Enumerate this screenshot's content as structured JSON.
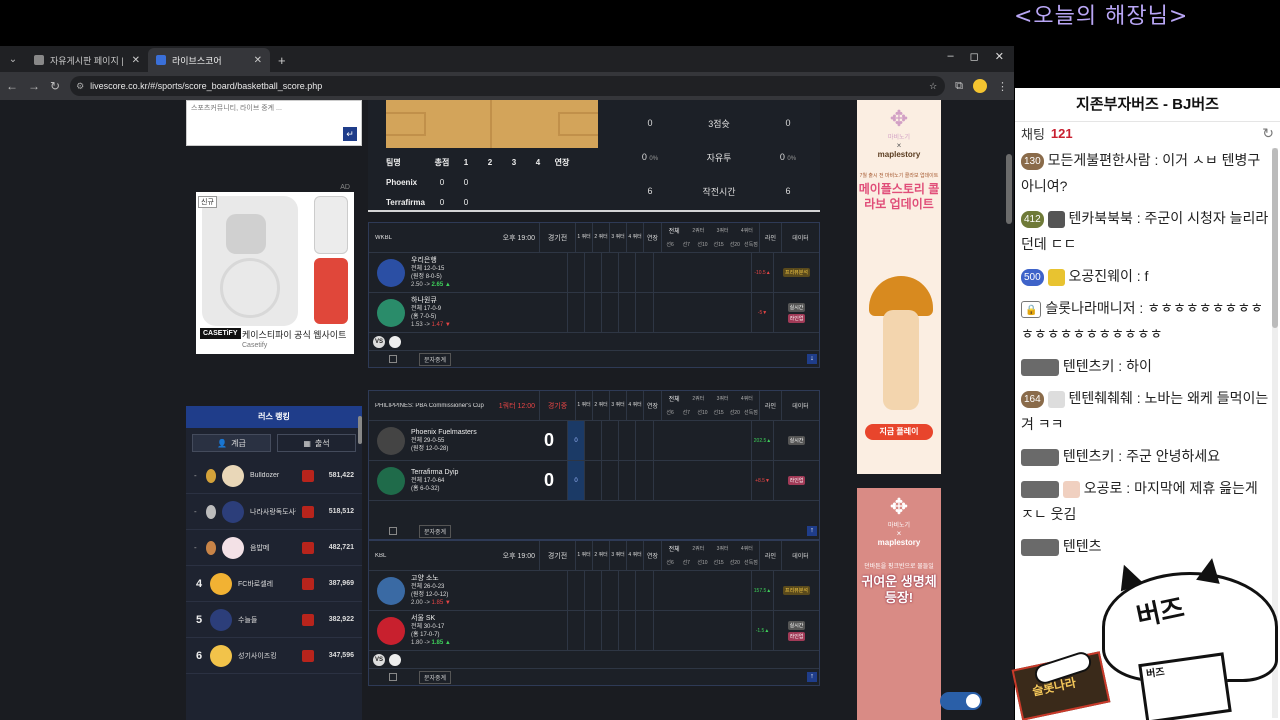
{
  "overlay": {
    "title": "<오늘의 해장님>"
  },
  "browser": {
    "tabs": [
      {
        "label": "자유게시판 페이지 | 쓸롯나라",
        "active": false
      },
      {
        "label": "라이브스코어",
        "active": true
      }
    ],
    "new_tab": "+",
    "url": "livescore.co.kr/#/sports/score_board/basketball_score.php",
    "controls": {
      "minimize": "–",
      "maximize": "◻",
      "close": "✕"
    }
  },
  "left": {
    "top_box_text": "스포츠커뮤니티, 라이브 중계 ...",
    "ad": {
      "label": "AD",
      "new": "신규",
      "brand": "CASETiFY",
      "title": "케이스티파이 공식 웹사이트",
      "sub": "Casetify"
    },
    "ranking": {
      "title": "러스 랭킹",
      "tabs": [
        "계급",
        "출석"
      ],
      "rows": [
        {
          "rank": "-",
          "medal": "gold",
          "name": "Bulldozer",
          "points": "581,422"
        },
        {
          "rank": "-",
          "medal": "silver",
          "name": "나라사랑독도사랑",
          "points": "518,512"
        },
        {
          "rank": "-",
          "medal": "bronze",
          "name": "음밥메",
          "points": "482,721"
        },
        {
          "rank": "4",
          "medal": "",
          "name": "FC바로셀레",
          "points": "387,969"
        },
        {
          "rank": "5",
          "medal": "",
          "name": "수늘들",
          "points": "382,922"
        },
        {
          "rank": "6",
          "medal": "",
          "name": "성기사이즈킹",
          "points": "347,596"
        }
      ]
    }
  },
  "top_game": {
    "quarter_headers": [
      "팀명",
      "총점",
      "1",
      "2",
      "3",
      "4",
      "연장"
    ],
    "teams": [
      {
        "name": "Phoenix",
        "total": "0",
        "q1": "0"
      },
      {
        "name": "Terrafirma",
        "total": "0",
        "q1": "0"
      }
    ],
    "stats": [
      {
        "left": "0",
        "label": "3점슛",
        "right": "0"
      },
      {
        "left": "0",
        "left_pct": "0%",
        "label": "자유투",
        "right": "0",
        "right_pct": "0%"
      },
      {
        "left": "6",
        "label": "작전시간",
        "right": "6"
      }
    ]
  },
  "games": [
    {
      "league": "WKBL",
      "time": "오후 19:00",
      "status": "경기전",
      "live": false,
      "home": {
        "name": "우리은행",
        "line1": "전체 12-0-15",
        "line2": "(원정 8-0-5)",
        "odds_a": "2.50 ->",
        "odds_b": "2.65 ▲",
        "line": "-10.5▲"
      },
      "away": {
        "name": "하나원큐",
        "line1": "전체 17-0-9",
        "line2": "(홈 7-0-5)",
        "odds_a": "1.53 ->",
        "odds_b": "1.47 ▼",
        "line": "-5▼"
      },
      "data_buttons": [
        "프리뷰분석",
        "실시간",
        "라인업"
      ],
      "sms": "문자중계",
      "arrow": "↓"
    },
    {
      "league": "PHILIPPINES: PBA Commissioner's Cup",
      "time": "1쿼터 12:00",
      "status": "경기중",
      "live": true,
      "home": {
        "name": "Phoenix Fuelmasters",
        "line1": "전체 29-0-55",
        "line2": "(원정 12-0-28)",
        "score": "0",
        "q1": "0",
        "line": "202.5▲"
      },
      "away": {
        "name": "Terrafirma Dyip",
        "line1": "전체 17-0-64",
        "line2": "(홈 6-0-32)",
        "score": "0",
        "q1": "0",
        "line": "+8.5▼"
      },
      "data_buttons": [
        "실시간",
        "라인업"
      ],
      "sms": "문자중계",
      "arrow": "↑"
    },
    {
      "league": "KBL",
      "time": "오후 19:00",
      "status": "경기전",
      "live": false,
      "home": {
        "name": "고양 소노",
        "line1": "전체 26-0-23",
        "line2": "(원정 12-0-12)",
        "odds_a": "2.00 ->",
        "odds_b": "1.85 ▼",
        "line": "157.5▲"
      },
      "away": {
        "name": "서울 SK",
        "line1": "전체 30-0-17",
        "line2": "(홈 17-0-7)",
        "odds_a": "1.80 ->",
        "odds_b": "1.85 ▲",
        "line": "-1.5▲"
      },
      "data_buttons": [
        "프리뷰분석",
        "실시간",
        "라인업"
      ],
      "sms": "문자중계",
      "arrow": "↑"
    }
  ],
  "grid_headers": {
    "q1": "1 쿼터",
    "q2": "2 쿼터",
    "q3": "3 쿼터",
    "q4": "4 쿼터",
    "ot": "연장",
    "odds_top": [
      "전체",
      "2쿼터",
      "3쿼터",
      "4쿼터"
    ],
    "odds_sub": [
      "선6",
      "선7",
      "선10",
      "선15",
      "선20",
      "선득점"
    ],
    "line": "라인",
    "data": "데이터",
    "vs": "VS"
  },
  "right_ads": {
    "ad1": {
      "logo": "마비노기",
      "x": "×",
      "brand": "maplestory",
      "small": "7월 출시 전 마비노기 콜라보 업데이트",
      "big": "메이플스토리 콜라보 업데이트",
      "button": "지금 플레이"
    },
    "ad2": {
      "logo": "마비노기",
      "x": "×",
      "brand": "maplestory",
      "small": "던바튼을 핑크빈으로 물들일",
      "big": "귀여운 생명체 등장!"
    }
  },
  "chat": {
    "title": "지존부자버즈 - BJ버즈",
    "count_label": "채팅",
    "count": "121",
    "messages": [
      {
        "badge": "130",
        "badge_style": "b1",
        "nick": "모든게불편한사람",
        "text": "이거 ㅅㅂ 텐병구 아니여?"
      },
      {
        "badge": "412",
        "badge_style": "b2",
        "nick": "텐카북북북",
        "text": "주군이 시청자 늘리라던데 ㄷㄷ"
      },
      {
        "badge": "500",
        "badge_style": "b3",
        "nick": "오공진웨이",
        "text": "f"
      },
      {
        "badge": "",
        "badge_style": "mgr",
        "nick": "슬롯나라매니저",
        "text": "ㅎㅎㅎㅎㅎㅎㅎㅎㅎㅎㅎㅎㅎㅎㅎㅎㅎㅎㅎㅎ"
      },
      {
        "badge": "",
        "badge_style": "sub",
        "nick": "텐텐츠키",
        "text": "하이"
      },
      {
        "badge": "164",
        "badge_style": "b1",
        "nick": "텐텐췌췌췌",
        "text": "노바는 왜케 들먹이는겨 ㅋㅋ"
      },
      {
        "badge": "",
        "badge_style": "sub",
        "nick": "텐텐츠키",
        "text": "주군 안녕하세요"
      },
      {
        "badge": "",
        "badge_style": "sub",
        "nick": "오공로",
        "text": "마지막에 제휴 읊는게 ㅈㄴ 웃김"
      },
      {
        "badge": "",
        "badge_style": "sub",
        "nick": "텐텐츠",
        "text": ""
      }
    ]
  },
  "mascot": {
    "face": "버즈",
    "keyboard": "버즈",
    "pad": "슬롯나라"
  }
}
